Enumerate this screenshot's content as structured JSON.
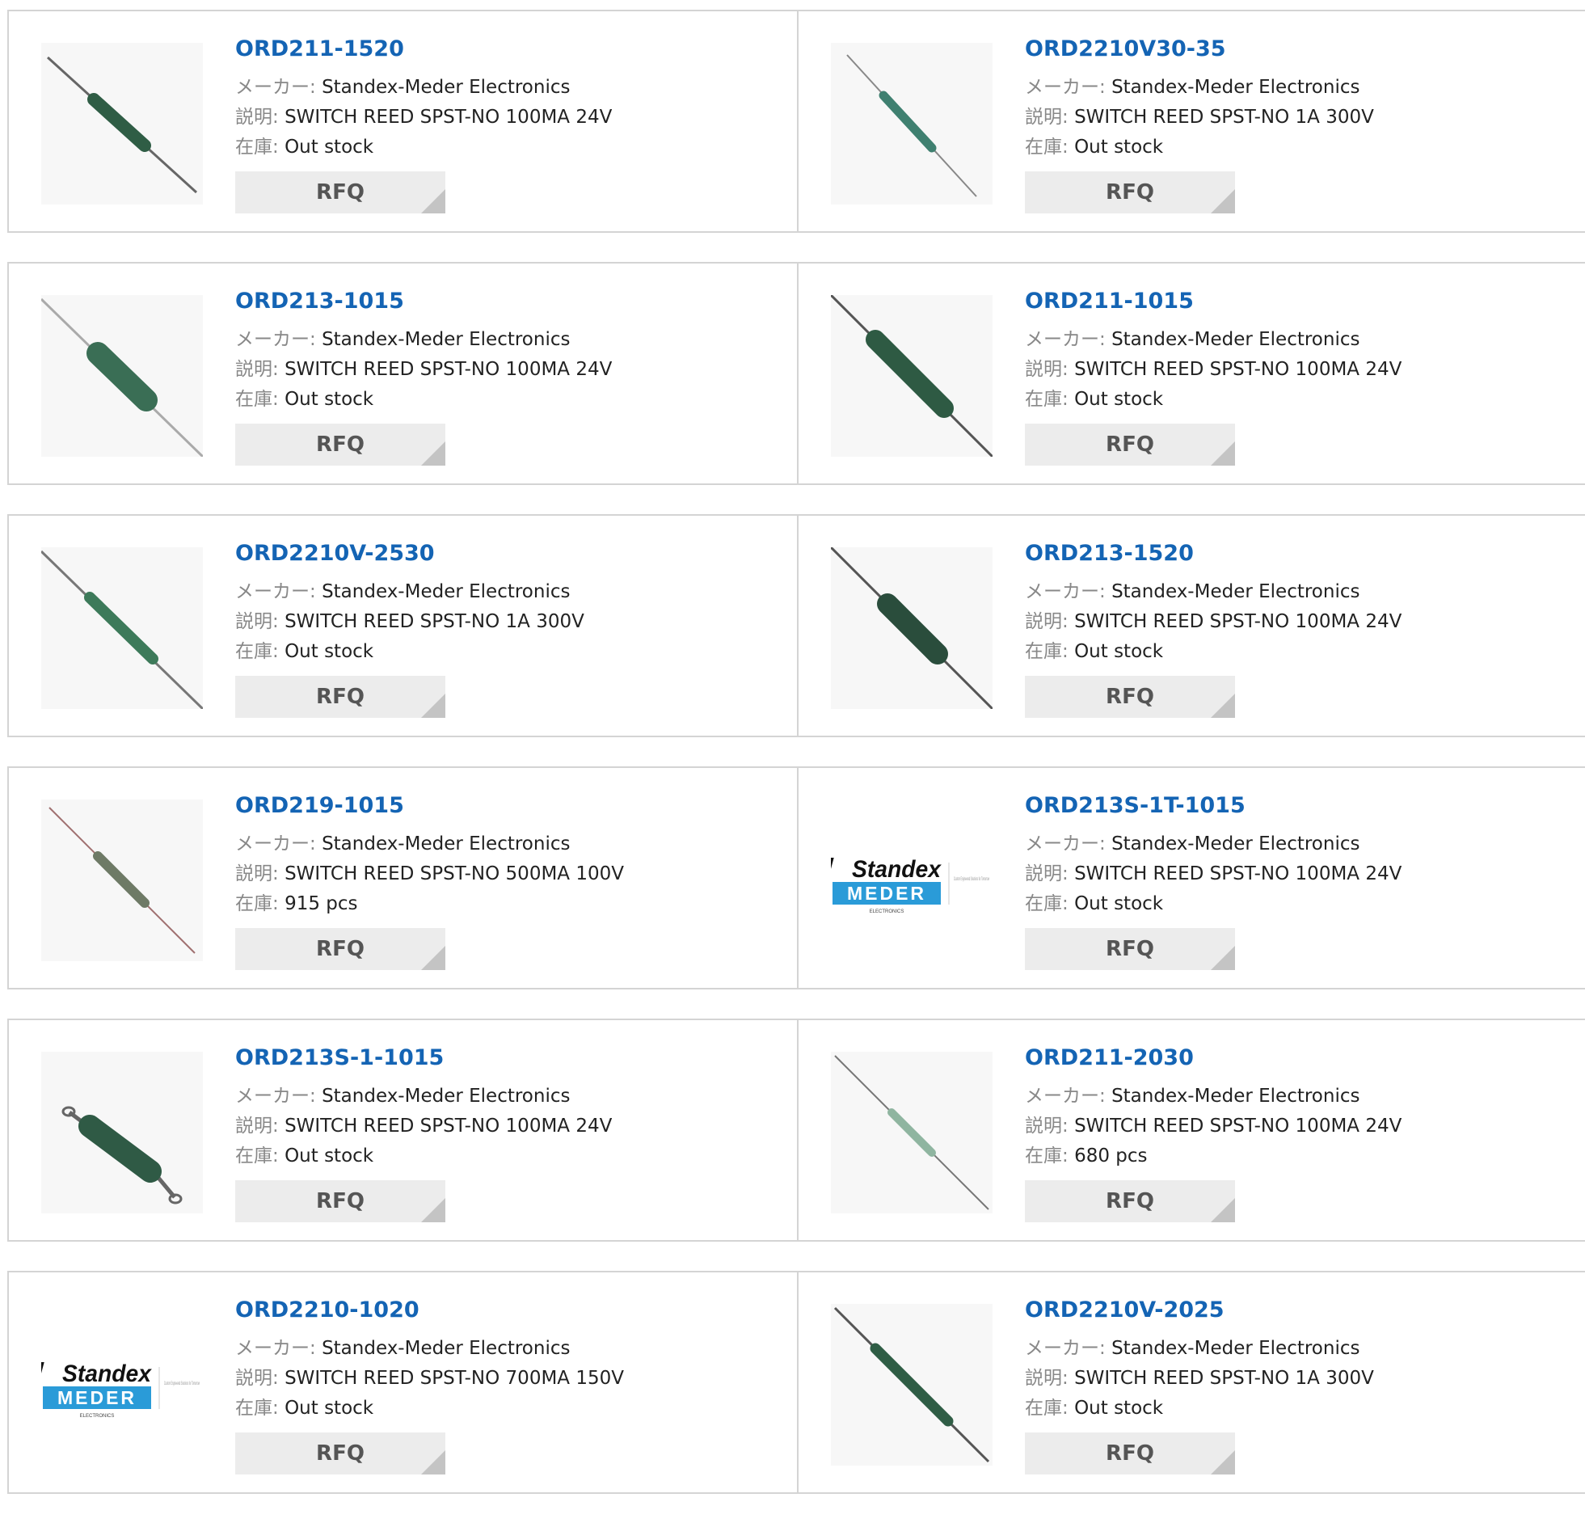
{
  "labels": {
    "maker": "メーカー:",
    "desc": "説明:",
    "stock": "在庫:",
    "rfq": "RFQ"
  },
  "colors": {
    "link": "#1464b4",
    "border": "#d4d4d4",
    "button_bg": "#ececec",
    "button_corner": "#c4c4c4"
  },
  "products": [
    {
      "pn": "ORD211-1520",
      "maker": "Standex-Meder Electronics",
      "desc": "SWITCH REED SPST-NO 100MA 24V",
      "stock": "Out stock",
      "image": "reed-switch-image"
    },
    {
      "pn": "ORD2210V30-35",
      "maker": "Standex-Meder Electronics",
      "desc": "SWITCH REED SPST-NO 1A 300V",
      "stock": "Out stock",
      "image": "reed-switch-image"
    },
    {
      "pn": "ORD213-1015",
      "maker": "Standex-Meder Electronics",
      "desc": "SWITCH REED SPST-NO 100MA 24V",
      "stock": "Out stock",
      "image": "reed-switch-image"
    },
    {
      "pn": "ORD211-1015",
      "maker": "Standex-Meder Electronics",
      "desc": "SWITCH REED SPST-NO 100MA 24V",
      "stock": "Out stock",
      "image": "reed-switch-image"
    },
    {
      "pn": "ORD2210V-2530",
      "maker": "Standex-Meder Electronics",
      "desc": "SWITCH REED SPST-NO 1A 300V",
      "stock": "Out stock",
      "image": "reed-switch-image"
    },
    {
      "pn": "ORD213-1520",
      "maker": "Standex-Meder Electronics",
      "desc": "SWITCH REED SPST-NO 100MA 24V",
      "stock": "Out stock",
      "image": "reed-switch-image"
    },
    {
      "pn": "ORD219-1015",
      "maker": "Standex-Meder Electronics",
      "desc": "SWITCH REED SPST-NO 500MA 100V",
      "stock": "915 pcs",
      "image": "reed-switch-image"
    },
    {
      "pn": "ORD213S-1T-1015",
      "maker": "Standex-Meder Electronics",
      "desc": "SWITCH REED SPST-NO 100MA 24V",
      "stock": "Out stock",
      "image": "standex-meder-logo",
      "logo": {
        "brand": "Standex",
        "sub": "MEDER",
        "tag": "ELECTRONICS",
        "side": "Custom Engineered Solutions for Tomorrow"
      }
    },
    {
      "pn": "ORD213S-1-1015",
      "maker": "Standex-Meder Electronics",
      "desc": "SWITCH REED SPST-NO 100MA 24V",
      "stock": "Out stock",
      "image": "reed-switch-image"
    },
    {
      "pn": "ORD211-2030",
      "maker": "Standex-Meder Electronics",
      "desc": "SWITCH REED SPST-NO 100MA 24V",
      "stock": "680 pcs",
      "image": "reed-switch-image"
    },
    {
      "pn": "ORD2210-1020",
      "maker": "Standex-Meder Electronics",
      "desc": "SWITCH REED SPST-NO 700MA 150V",
      "stock": "Out stock",
      "image": "standex-meder-logo",
      "logo": {
        "brand": "Standex",
        "sub": "MEDER",
        "tag": "ELECTRONICS",
        "side": "Custom Engineered Solutions for Tomorrow"
      }
    },
    {
      "pn": "ORD2210V-2025",
      "maker": "Standex-Meder Electronics",
      "desc": "SWITCH REED SPST-NO 1A 300V",
      "stock": "Out stock",
      "image": "reed-switch-image"
    }
  ]
}
